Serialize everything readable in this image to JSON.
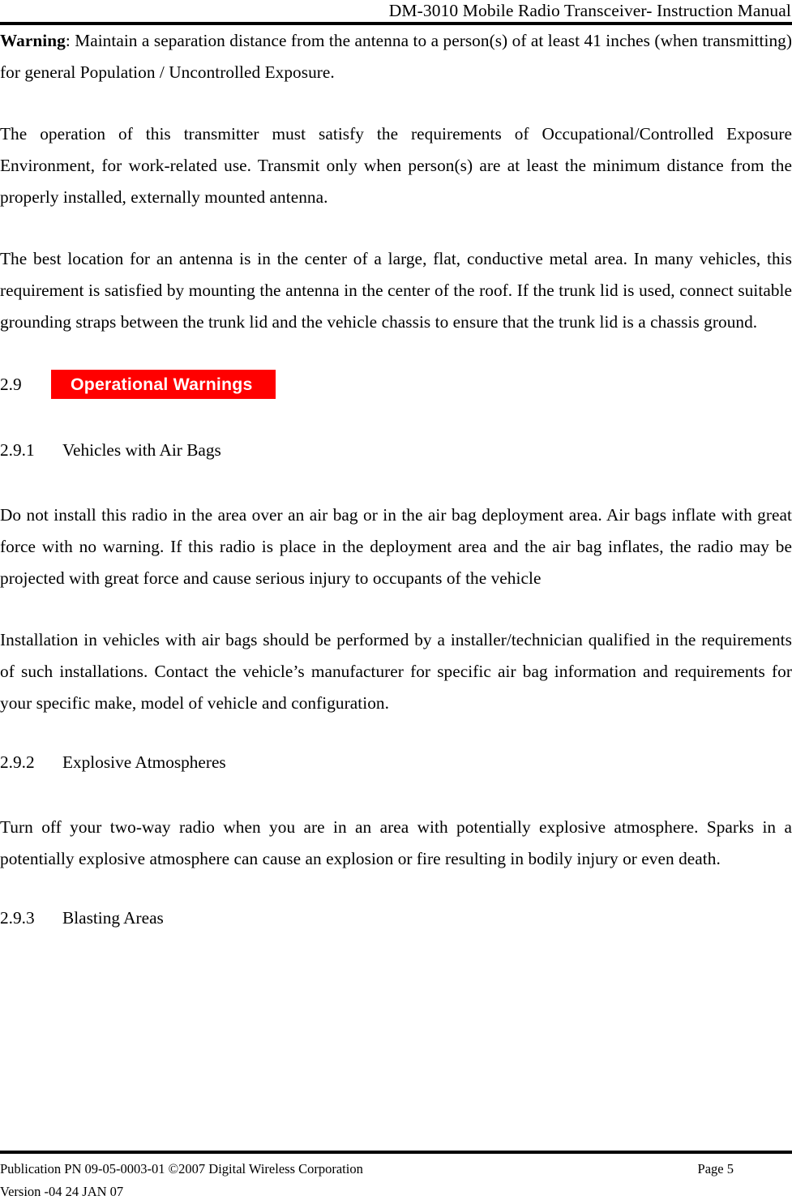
{
  "header": {
    "title": "DM-3010 Mobile Radio Transceiver- Instruction Manual"
  },
  "body": {
    "warning_label": "Warning",
    "warning_text": ": Maintain a separation distance from the antenna to a person(s) of at least 41 inches (when transmitting) for general Population / Uncontrolled Exposure.",
    "para_operation": "The operation of this transmitter must satisfy the requirements of Occupational/Controlled Exposure Environment, for work-related use. Transmit only when person(s) are at least the minimum distance from the properly installed, externally mounted antenna.",
    "para_location": "The best location for an antenna is in the center of a large, flat, conductive metal area. In many vehicles, this requirement is satisfied by mounting the antenna in the center of the roof. If the trunk lid is used, connect suitable grounding straps between the trunk lid and the vehicle chassis to ensure that the trunk lid is a chassis ground.",
    "section_2_9": {
      "number": "2.9",
      "title": "Operational Warnings",
      "highlight_color": "#ff0000",
      "title_color": "#ffffff"
    },
    "section_2_9_1": {
      "number": "2.9.1",
      "title": "Vehicles with Air Bags",
      "para_1": "Do not install this radio in the area over an air bag or in the air bag deployment area.  Air bags inflate with great force with no warning. If this radio is place in the deployment area and the air bag inflates, the radio may be projected with great force and cause serious injury to occupants of the vehicle",
      "para_2": "Installation in vehicles with air bags should be performed by a installer/technician qualified in the requirements of such installations. Contact the vehicle’s manufacturer for specific air bag information and requirements for your specific make, model of vehicle and configuration."
    },
    "section_2_9_2": {
      "number": "2.9.2",
      "title": "Explosive Atmospheres",
      "para_1": "Turn off your two-way radio when you are in an area with potentially explosive atmosphere. Sparks in a potentially explosive atmosphere can cause an explosion or fire resulting in bodily injury or even death."
    },
    "section_2_9_3": {
      "number": "2.9.3",
      "title": "Blasting Areas"
    }
  },
  "footer": {
    "publication": "Publication PN 09-05-0003-01 ©2007 Digital Wireless Corporation",
    "page": "Page 5",
    "version": "Version -04 24 JAN 07"
  }
}
